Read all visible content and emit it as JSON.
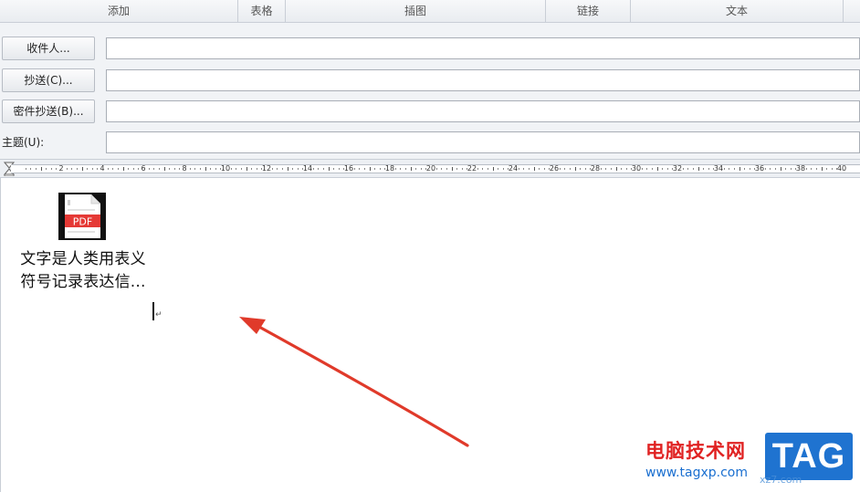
{
  "ribbon": {
    "groups": [
      "添加",
      "表格",
      "插图",
      "链接",
      "文本"
    ]
  },
  "header": {
    "to_button": "收件人...",
    "cc_button": "抄送(C)...",
    "bcc_button": "密件抄送(B)...",
    "subject_label": "主题(U):",
    "to_value": "",
    "cc_value": "",
    "bcc_value": "",
    "subject_value": ""
  },
  "ruler": {
    "numbers": [
      "2",
      "4",
      "6",
      "8",
      "10",
      "12",
      "14",
      "16",
      "18",
      "20",
      "22",
      "24",
      "26",
      "28",
      "30",
      "32",
      "34",
      "36",
      "38",
      "40"
    ]
  },
  "attachment": {
    "icon_text": "PDF",
    "name_line1": "文字是人类用表义",
    "name_line2": "符号记录表达信..."
  },
  "colors": {
    "arrow": "#e03a2a",
    "pdf_band": "#e53935",
    "watermark_red": "#e02222",
    "watermark_blue": "#1f73d0"
  },
  "watermark": {
    "site_name": "电脑技术网",
    "url": "www.tagxp.com",
    "badge": "TAG",
    "sub": "xz7.com"
  }
}
